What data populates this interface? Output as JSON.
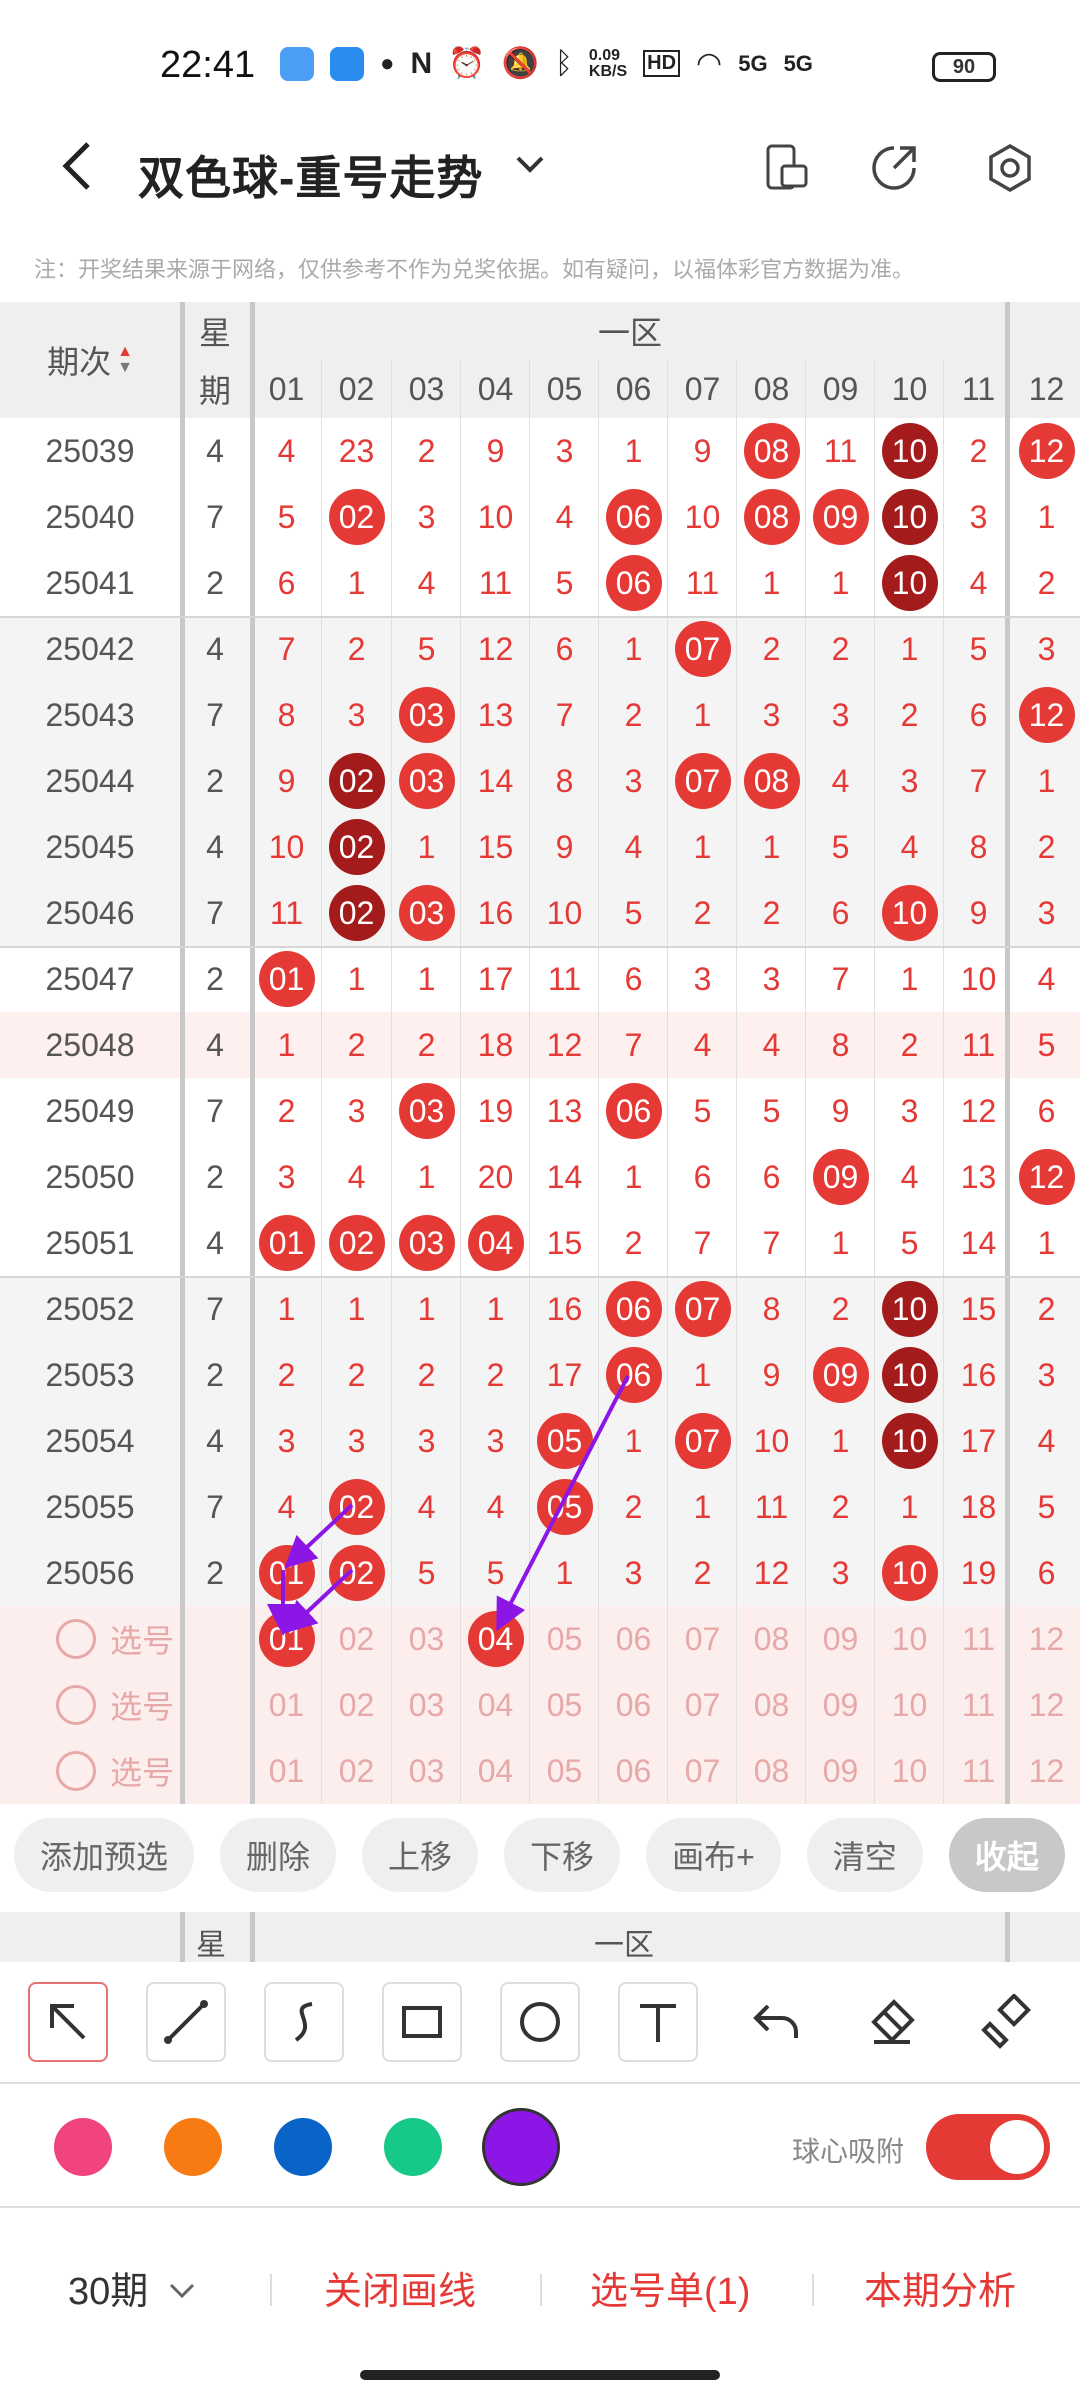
{
  "status": {
    "time": "22:41",
    "net_speed": "0.09\nKB/S",
    "signal1": "5G",
    "signal2": "5G",
    "battery": "90"
  },
  "header": {
    "title": "双色球-重号走势"
  },
  "notice": "注：开奖结果来源于网络，仅供参考不作为兑奖依据。如有疑问，以福体彩官方数据为准。",
  "table": {
    "col_period": "期次",
    "col_week_top": "星",
    "col_week_bottom": "期",
    "zone_label": "一区",
    "numbers": [
      "01",
      "02",
      "03",
      "04",
      "05",
      "06",
      "07",
      "08",
      "09",
      "10",
      "11",
      "12"
    ],
    "rows": [
      {
        "period": "25039",
        "week": "4",
        "cells": [
          "4",
          "23",
          "2",
          "9",
          "3",
          "1",
          "9",
          "08",
          "11",
          "10",
          "2",
          "12"
        ],
        "balls": {
          "7": "r",
          "9": "d",
          "11": "r"
        }
      },
      {
        "period": "25040",
        "week": "7",
        "cells": [
          "5",
          "02",
          "3",
          "10",
          "4",
          "06",
          "10",
          "08",
          "09",
          "10",
          "3",
          "1"
        ],
        "balls": {
          "1": "r",
          "5": "r",
          "7": "r",
          "8": "r",
          "9": "d"
        }
      },
      {
        "period": "25041",
        "week": "2",
        "cells": [
          "6",
          "1",
          "4",
          "11",
          "5",
          "06",
          "11",
          "1",
          "1",
          "10",
          "4",
          "2"
        ],
        "balls": {
          "5": "r",
          "9": "d"
        }
      },
      {
        "period": "25042",
        "week": "4",
        "cells": [
          "7",
          "2",
          "5",
          "12",
          "6",
          "1",
          "07",
          "2",
          "2",
          "1",
          "5",
          "3"
        ],
        "balls": {
          "6": "r"
        }
      },
      {
        "period": "25043",
        "week": "7",
        "cells": [
          "8",
          "3",
          "03",
          "13",
          "7",
          "2",
          "1",
          "3",
          "3",
          "2",
          "6",
          "12"
        ],
        "balls": {
          "2": "r",
          "11": "r"
        }
      },
      {
        "period": "25044",
        "week": "2",
        "cells": [
          "9",
          "02",
          "03",
          "14",
          "8",
          "3",
          "07",
          "08",
          "4",
          "3",
          "7",
          "1"
        ],
        "balls": {
          "1": "d",
          "2": "r",
          "6": "r",
          "7": "r"
        }
      },
      {
        "period": "25045",
        "week": "4",
        "cells": [
          "10",
          "02",
          "1",
          "15",
          "9",
          "4",
          "1",
          "1",
          "5",
          "4",
          "8",
          "2"
        ],
        "balls": {
          "1": "d"
        }
      },
      {
        "period": "25046",
        "week": "7",
        "cells": [
          "11",
          "02",
          "03",
          "16",
          "10",
          "5",
          "2",
          "2",
          "6",
          "10",
          "9",
          "3"
        ],
        "balls": {
          "1": "d",
          "2": "r",
          "9": "r"
        }
      },
      {
        "period": "25047",
        "week": "2",
        "cells": [
          "01",
          "1",
          "1",
          "17",
          "11",
          "6",
          "3",
          "3",
          "7",
          "1",
          "10",
          "4"
        ],
        "balls": {
          "0": "r"
        }
      },
      {
        "period": "25048",
        "week": "4",
        "cells": [
          "1",
          "2",
          "2",
          "18",
          "12",
          "7",
          "4",
          "4",
          "8",
          "2",
          "11",
          "5"
        ],
        "balls": {}
      },
      {
        "period": "25049",
        "week": "7",
        "cells": [
          "2",
          "3",
          "03",
          "19",
          "13",
          "06",
          "5",
          "5",
          "9",
          "3",
          "12",
          "6"
        ],
        "balls": {
          "2": "r",
          "5": "r"
        }
      },
      {
        "period": "25050",
        "week": "2",
        "cells": [
          "3",
          "4",
          "1",
          "20",
          "14",
          "1",
          "6",
          "6",
          "09",
          "4",
          "13",
          "12"
        ],
        "balls": {
          "8": "r",
          "11": "r"
        }
      },
      {
        "period": "25051",
        "week": "4",
        "cells": [
          "01",
          "02",
          "03",
          "04",
          "15",
          "2",
          "7",
          "7",
          "1",
          "5",
          "14",
          "1"
        ],
        "balls": {
          "0": "r",
          "1": "r",
          "2": "r",
          "3": "r"
        }
      },
      {
        "period": "25052",
        "week": "7",
        "cells": [
          "1",
          "1",
          "1",
          "1",
          "16",
          "06",
          "07",
          "8",
          "2",
          "10",
          "15",
          "2"
        ],
        "balls": {
          "5": "r",
          "6": "r",
          "9": "d"
        }
      },
      {
        "period": "25053",
        "week": "2",
        "cells": [
          "2",
          "2",
          "2",
          "2",
          "17",
          "06",
          "1",
          "9",
          "09",
          "10",
          "16",
          "3"
        ],
        "balls": {
          "5": "r",
          "8": "r",
          "9": "d"
        }
      },
      {
        "period": "25054",
        "week": "4",
        "cells": [
          "3",
          "3",
          "3",
          "3",
          "05",
          "1",
          "07",
          "10",
          "1",
          "10",
          "17",
          "4"
        ],
        "balls": {
          "4": "r",
          "6": "r",
          "9": "d"
        }
      },
      {
        "period": "25055",
        "week": "7",
        "cells": [
          "4",
          "02",
          "4",
          "4",
          "05",
          "2",
          "1",
          "11",
          "2",
          "1",
          "18",
          "5"
        ],
        "balls": {
          "1": "r",
          "4": "r"
        }
      },
      {
        "period": "25056",
        "week": "2",
        "cells": [
          "01",
          "02",
          "5",
          "5",
          "1",
          "3",
          "2",
          "12",
          "3",
          "10",
          "19",
          "6"
        ],
        "balls": {
          "0": "r",
          "1": "r",
          "9": "r"
        }
      }
    ],
    "pick_label": "选号",
    "pick_rows": [
      {
        "balls": {
          "0": "r",
          "3": "r"
        }
      },
      {
        "balls": {}
      },
      {
        "balls": {}
      }
    ]
  },
  "actions": [
    "添加预选",
    "删除",
    "上移",
    "下移",
    "画布+",
    "清空",
    "收起"
  ],
  "mini_header": {
    "week": "星",
    "zone": "一区"
  },
  "tools": [
    "select-arrow",
    "line",
    "curve",
    "rectangle",
    "circle",
    "text",
    "undo",
    "eraser",
    "clear-brush"
  ],
  "colors": [
    "#f0437f",
    "#f77b12",
    "#0a64c8",
    "#17c988",
    "#8b16e6"
  ],
  "snap_label": "球心吸附",
  "bottom": {
    "periods": "30期",
    "close_draw": "关闭画线",
    "pick_list": "选号单(1)",
    "analysis": "本期分析"
  },
  "accent": "#e53935"
}
